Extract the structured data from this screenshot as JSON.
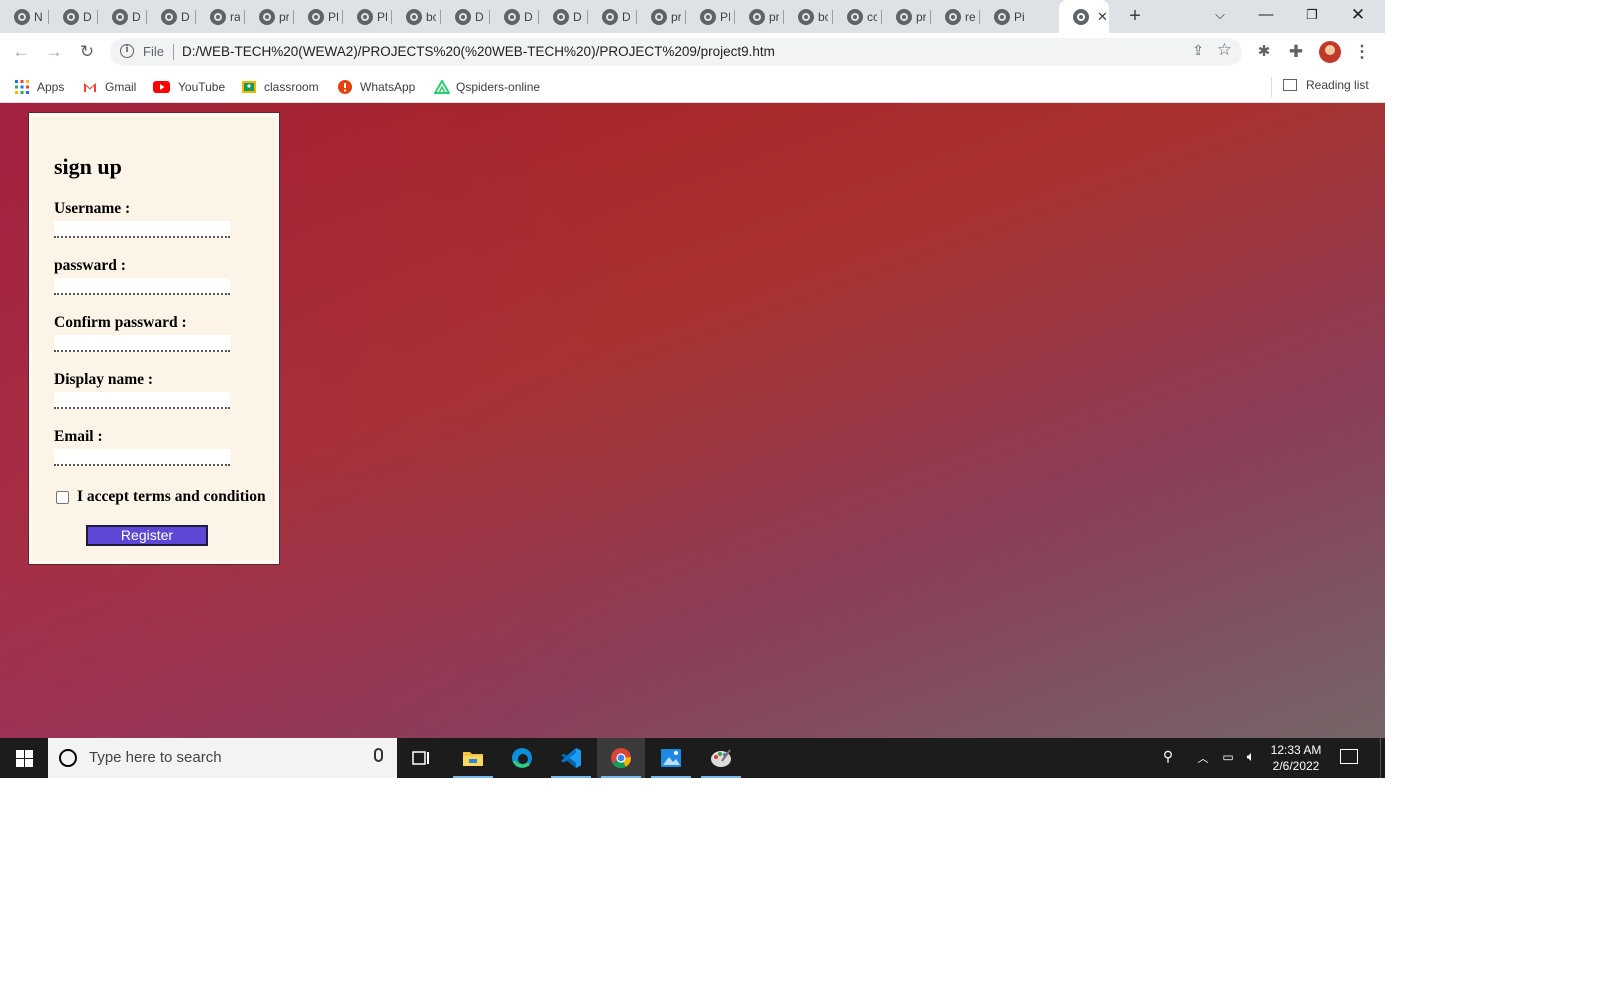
{
  "browser": {
    "tabs": [
      {
        "label": "N"
      },
      {
        "label": "D"
      },
      {
        "label": "D"
      },
      {
        "label": "D"
      },
      {
        "label": "ra"
      },
      {
        "label": "pr"
      },
      {
        "label": "PF"
      },
      {
        "label": "PF"
      },
      {
        "label": "bc"
      },
      {
        "label": "D"
      },
      {
        "label": "D"
      },
      {
        "label": "D"
      },
      {
        "label": "D"
      },
      {
        "label": "pr"
      },
      {
        "label": "PI"
      },
      {
        "label": "pr"
      },
      {
        "label": "bc"
      },
      {
        "label": "cc"
      },
      {
        "label": "pr"
      },
      {
        "label": "re"
      },
      {
        "label": "Pi"
      }
    ],
    "active_tab_close": "✕",
    "new_tab": "+",
    "omnibox": {
      "scheme": "File",
      "url": "D:/WEB-TECH%20(WEWA2)/PROJECTS%20(%20WEB-TECH%20)/PROJECT%209/project9.htm"
    },
    "bookmarks": [
      {
        "label": "Apps",
        "icon": "apps-grid-icon"
      },
      {
        "label": "Gmail",
        "icon": "gmail-icon"
      },
      {
        "label": "YouTube",
        "icon": "youtube-icon"
      },
      {
        "label": "classroom",
        "icon": "classroom-icon"
      },
      {
        "label": "WhatsApp",
        "icon": "whatsapp-icon"
      },
      {
        "label": "Qspiders-online",
        "icon": "qspiders-icon"
      }
    ],
    "reading_list": "Reading list"
  },
  "form": {
    "title": "sign up",
    "fields": [
      {
        "label": "Username :",
        "value": ""
      },
      {
        "label": "passward :",
        "value": ""
      },
      {
        "label": "Confirm passward :",
        "value": ""
      },
      {
        "label": "Display name :",
        "value": ""
      },
      {
        "label": "Email :",
        "value": ""
      }
    ],
    "terms_label": "I accept terms and condition",
    "terms_checked": false,
    "register_label": "Register"
  },
  "taskbar": {
    "search_placeholder": "Type here to search",
    "time": "12:33 AM",
    "date": "2/6/2022",
    "apps": [
      "task-view",
      "file-explorer",
      "edge",
      "vscode",
      "chrome",
      "photos",
      "paint"
    ]
  },
  "colors": {
    "page_gradient_start": "#a51e26",
    "page_gradient_end": "#756668",
    "form_background": "#fcf5e7",
    "register_button": "#5c47d6",
    "taskbar": "#1c1c1c"
  }
}
